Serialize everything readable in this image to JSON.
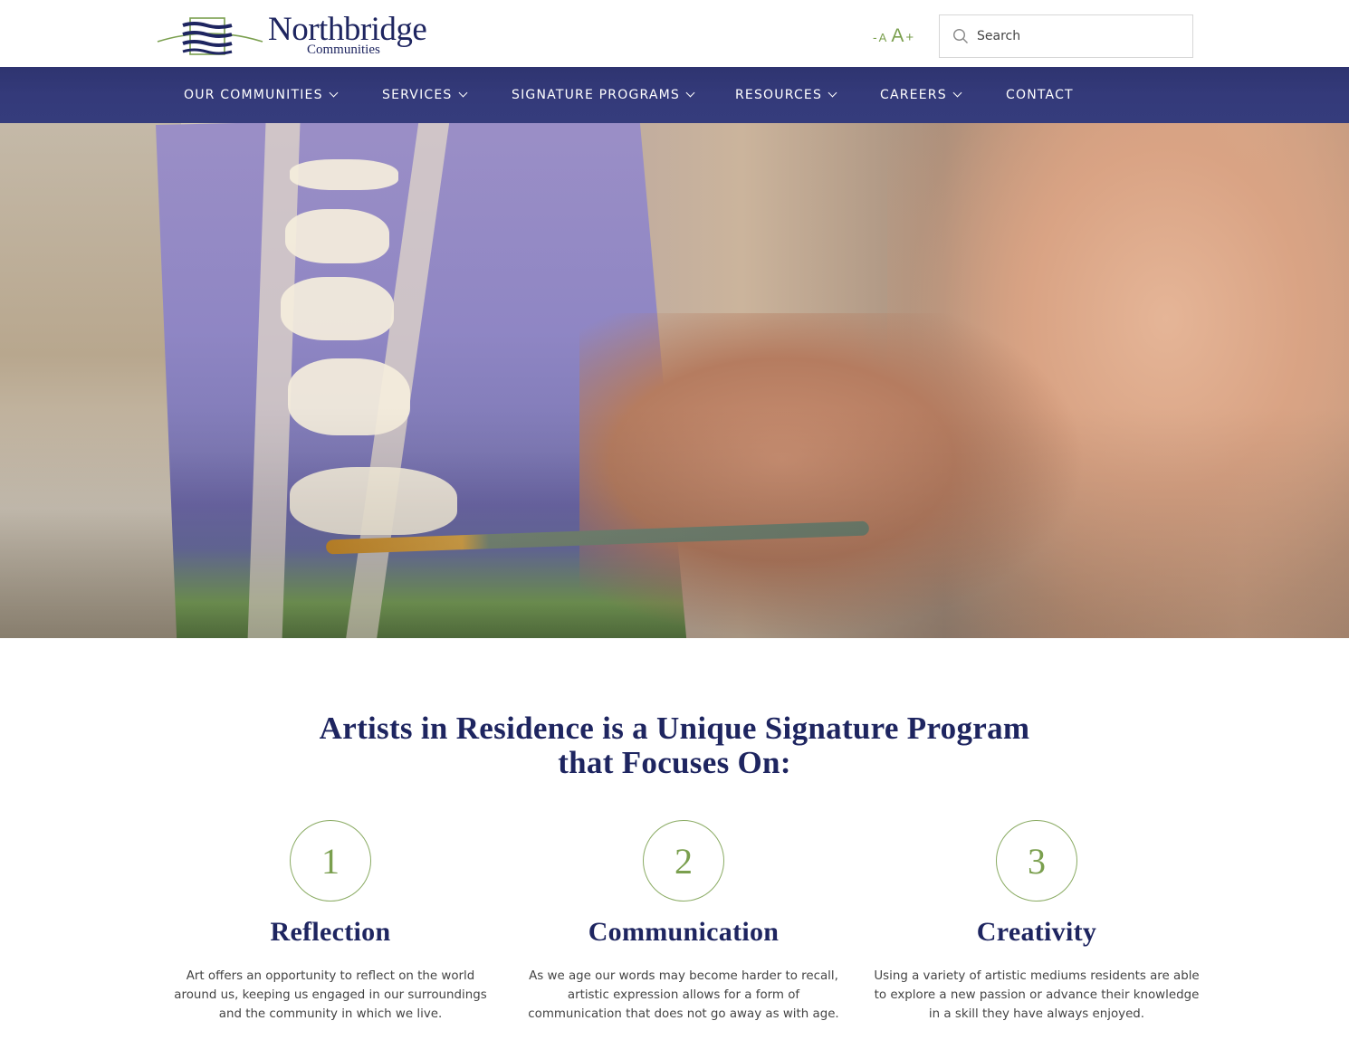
{
  "header": {
    "logo": {
      "name": "Northbridge",
      "sub": "Communities"
    },
    "font_size": {
      "decrease": "-",
      "small_a": "A",
      "large_a": "A",
      "increase": "+"
    },
    "search": {
      "placeholder": "Search",
      "value": ""
    }
  },
  "nav": {
    "items": [
      {
        "label": "OUR COMMUNITIES",
        "has_dropdown": true
      },
      {
        "label": "SERVICES",
        "has_dropdown": true
      },
      {
        "label": "SIGNATURE PROGRAMS",
        "has_dropdown": true
      },
      {
        "label": "RESOURCES",
        "has_dropdown": true
      },
      {
        "label": "CAREERS",
        "has_dropdown": true
      },
      {
        "label": "CONTACT",
        "has_dropdown": false
      }
    ]
  },
  "hero": {
    "title": "Artists in Residence",
    "image_description": "Elderly man painting on a canvas with a brush"
  },
  "intro": {
    "heading_line1": "Artists in Residence is a Unique Signature Program",
    "heading_line2": "that Focuses On:"
  },
  "features": [
    {
      "number": "1",
      "title": "Reflection",
      "text": "Art offers an opportunity to reflect on the world around us, keeping us engaged in our surroundings and the community in which we live."
    },
    {
      "number": "2",
      "title": "Communication",
      "text": "As we age our words may become harder to recall, artistic expression allows for a form of communication that does not go away as with age."
    },
    {
      "number": "3",
      "title": "Creativity",
      "text": "Using a variety of artistic mediums residents are able to explore a new passion or advance their knowledge in a skill they have always enjoyed."
    }
  ],
  "colors": {
    "brand_navy": "#1e2560",
    "nav_bg": "#343a7a",
    "accent_green": "#7a9f4e",
    "body_text": "#444444"
  }
}
